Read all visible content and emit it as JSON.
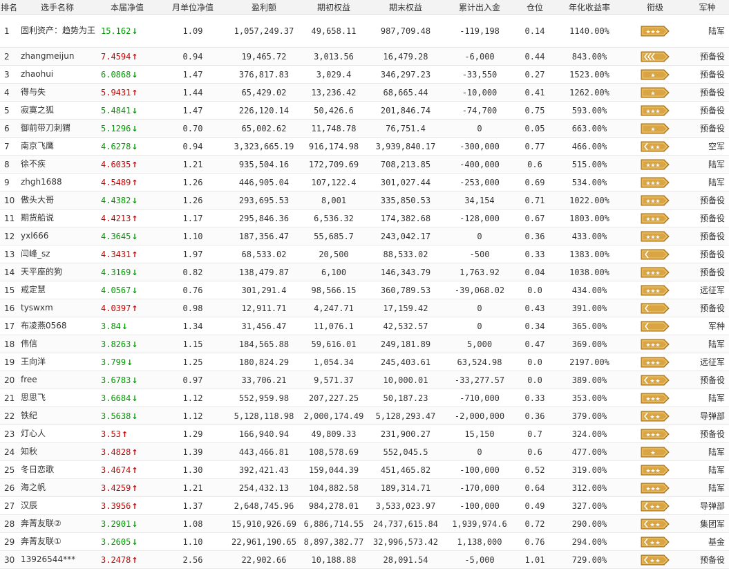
{
  "headers": {
    "rank": "排名",
    "name": "选手名称",
    "nav": "本届净值",
    "monthly": "月单位净值",
    "profit": "盈利额",
    "start": "期初权益",
    "end": "期末权益",
    "flow": "累计出入金",
    "position": "仓位",
    "annual": "年化收益率",
    "rankinsig": "衔级",
    "branch": "军种"
  },
  "colors": {
    "up": "#cc0000",
    "down": "#009900",
    "badge_fill": "#d9a441",
    "badge_border": "#9c6b14"
  },
  "rows": [
    {
      "rank": "1",
      "name": "固利资产：趋势为王",
      "nav": "15.162",
      "dir": "down",
      "monthly": "1.09",
      "profit": "1,057,249.37",
      "start": "49,658.11",
      "end": "987,709.48",
      "flow": "-119,198",
      "position": "0.14",
      "annual": "1140.00%",
      "insignia": "stars",
      "branch": "陆军"
    },
    {
      "rank": "2",
      "name": "zhangmeijun",
      "nav": "7.4594",
      "dir": "up",
      "monthly": "0.94",
      "profit": "19,465.72",
      "start": "3,013.56",
      "end": "16,479.28",
      "flow": "-6,000",
      "position": "0.44",
      "annual": "843.00%",
      "insignia": "chevron-double",
      "branch": "预备役"
    },
    {
      "rank": "3",
      "name": "zhaohui",
      "nav": "6.0868",
      "dir": "down",
      "monthly": "1.47",
      "profit": "376,817.83",
      "start": "3,029.4",
      "end": "346,297.23",
      "flow": "-33,550",
      "position": "0.27",
      "annual": "1523.00%",
      "insignia": "star",
      "branch": "预备役"
    },
    {
      "rank": "4",
      "name": "得与失",
      "nav": "5.9431",
      "dir": "up",
      "monthly": "1.44",
      "profit": "65,429.02",
      "start": "13,236.42",
      "end": "68,665.44",
      "flow": "-10,000",
      "position": "0.41",
      "annual": "1262.00%",
      "insignia": "star",
      "branch": "预备役"
    },
    {
      "rank": "5",
      "name": "寂寞之狐",
      "nav": "5.4841",
      "dir": "down",
      "monthly": "1.47",
      "profit": "226,120.14",
      "start": "50,426.6",
      "end": "201,846.74",
      "flow": "-74,700",
      "position": "0.75",
      "annual": "593.00%",
      "insignia": "stars",
      "branch": "预备役"
    },
    {
      "rank": "6",
      "name": "御前带刀刺猬",
      "nav": "5.1296",
      "dir": "down",
      "monthly": "0.70",
      "profit": "65,002.62",
      "start": "11,748.78",
      "end": "76,751.4",
      "flow": "0",
      "position": "0.05",
      "annual": "663.00%",
      "insignia": "star",
      "branch": "预备役"
    },
    {
      "rank": "7",
      "name": "南京飞鹰",
      "nav": "4.6278",
      "dir": "down",
      "monthly": "0.94",
      "profit": "3,323,665.19",
      "start": "916,174.98",
      "end": "3,939,840.17",
      "flow": "-300,000",
      "position": "0.77",
      "annual": "466.00%",
      "insignia": "chevron-stars",
      "branch": "空军"
    },
    {
      "rank": "8",
      "name": "徐不疾",
      "nav": "4.6035",
      "dir": "up",
      "monthly": "1.21",
      "profit": "935,504.16",
      "start": "172,709.69",
      "end": "708,213.85",
      "flow": "-400,000",
      "position": "0.6",
      "annual": "515.00%",
      "insignia": "stars",
      "branch": "陆军"
    },
    {
      "rank": "9",
      "name": "zhgh1688",
      "nav": "4.5489",
      "dir": "up",
      "monthly": "1.26",
      "profit": "446,905.04",
      "start": "107,122.4",
      "end": "301,027.44",
      "flow": "-253,000",
      "position": "0.69",
      "annual": "534.00%",
      "insignia": "stars",
      "branch": "陆军"
    },
    {
      "rank": "10",
      "name": "傲头大哥",
      "nav": "4.4382",
      "dir": "down",
      "monthly": "1.26",
      "profit": "293,695.53",
      "start": "8,001",
      "end": "335,850.53",
      "flow": "34,154",
      "position": "0.71",
      "annual": "1022.00%",
      "insignia": "stars",
      "branch": "预备役"
    },
    {
      "rank": "11",
      "name": "期货船说",
      "nav": "4.4213",
      "dir": "up",
      "monthly": "1.17",
      "profit": "295,846.36",
      "start": "6,536.32",
      "end": "174,382.68",
      "flow": "-128,000",
      "position": "0.67",
      "annual": "1803.00%",
      "insignia": "stars",
      "branch": "预备役"
    },
    {
      "rank": "12",
      "name": "yxl666",
      "nav": "4.3645",
      "dir": "down",
      "monthly": "1.10",
      "profit": "187,356.47",
      "start": "55,685.7",
      "end": "243,042.17",
      "flow": "0",
      "position": "0.36",
      "annual": "433.00%",
      "insignia": "stars",
      "branch": "预备役"
    },
    {
      "rank": "13",
      "name": "闫峰_sz",
      "nav": "4.3431",
      "dir": "up",
      "monthly": "1.97",
      "profit": "68,533.02",
      "start": "20,500",
      "end": "88,533.02",
      "flow": "-500",
      "position": "0.33",
      "annual": "1383.00%",
      "insignia": "chevron",
      "branch": "预备役"
    },
    {
      "rank": "14",
      "name": "天平座的狗",
      "nav": "4.3169",
      "dir": "down",
      "monthly": "0.82",
      "profit": "138,479.87",
      "start": "6,100",
      "end": "146,343.79",
      "flow": "1,763.92",
      "position": "0.04",
      "annual": "1038.00%",
      "insignia": "stars",
      "branch": "预备役"
    },
    {
      "rank": "15",
      "name": "戒定慧",
      "nav": "4.0567",
      "dir": "down",
      "monthly": "0.76",
      "profit": "301,291.4",
      "start": "98,566.15",
      "end": "360,789.53",
      "flow": "-39,068.02",
      "position": "0.0",
      "annual": "434.00%",
      "insignia": "stars",
      "branch": "远征军"
    },
    {
      "rank": "16",
      "name": "tyswxm",
      "nav": "4.0397",
      "dir": "up",
      "monthly": "0.98",
      "profit": "12,911.71",
      "start": "4,247.71",
      "end": "17,159.42",
      "flow": "0",
      "position": "0.43",
      "annual": "391.00%",
      "insignia": "chevron",
      "branch": "预备役"
    },
    {
      "rank": "17",
      "name": "布凌燕0568",
      "nav": "3.84",
      "dir": "down",
      "monthly": "1.34",
      "profit": "31,456.47",
      "start": "11,076.1",
      "end": "42,532.57",
      "flow": "0",
      "position": "0.34",
      "annual": "365.00%",
      "insignia": "chevron",
      "branch": "军种"
    },
    {
      "rank": "18",
      "name": "伟信",
      "nav": "3.8263",
      "dir": "down",
      "monthly": "1.15",
      "profit": "184,565.88",
      "start": "59,616.01",
      "end": "249,181.89",
      "flow": "5,000",
      "position": "0.47",
      "annual": "369.00%",
      "insignia": "stars",
      "branch": "陆军"
    },
    {
      "rank": "19",
      "name": "王向洋",
      "nav": "3.799",
      "dir": "down",
      "monthly": "1.25",
      "profit": "180,824.29",
      "start": "1,054.34",
      "end": "245,403.61",
      "flow": "63,524.98",
      "position": "0.0",
      "annual": "2197.00%",
      "insignia": "stars",
      "branch": "远征军"
    },
    {
      "rank": "20",
      "name": "free",
      "nav": "3.6783",
      "dir": "down",
      "monthly": "0.97",
      "profit": "33,706.21",
      "start": "9,571.37",
      "end": "10,000.01",
      "flow": "-33,277.57",
      "position": "0.0",
      "annual": "389.00%",
      "insignia": "chevron-stars",
      "branch": "预备役"
    },
    {
      "rank": "21",
      "name": "思思飞",
      "nav": "3.6684",
      "dir": "down",
      "monthly": "1.12",
      "profit": "552,959.98",
      "start": "207,227.25",
      "end": "50,187.23",
      "flow": "-710,000",
      "position": "0.33",
      "annual": "353.00%",
      "insignia": "stars",
      "branch": "陆军"
    },
    {
      "rank": "22",
      "name": "铁纪",
      "nav": "3.5638",
      "dir": "down",
      "monthly": "1.12",
      "profit": "5,128,118.98",
      "start": "2,000,174.49",
      "end": "5,128,293.47",
      "flow": "-2,000,000",
      "position": "0.36",
      "annual": "379.00%",
      "insignia": "chevron-stars",
      "branch": "导弹部"
    },
    {
      "rank": "23",
      "name": "灯心人",
      "nav": "3.53",
      "dir": "up",
      "monthly": "1.29",
      "profit": "166,940.94",
      "start": "49,809.33",
      "end": "231,900.27",
      "flow": "15,150",
      "position": "0.7",
      "annual": "324.00%",
      "insignia": "stars",
      "branch": "预备役"
    },
    {
      "rank": "24",
      "name": "知秋",
      "nav": "3.4828",
      "dir": "up",
      "monthly": "1.39",
      "profit": "443,466.81",
      "start": "108,578.69",
      "end": "552,045.5",
      "flow": "0",
      "position": "0.6",
      "annual": "477.00%",
      "insignia": "star",
      "branch": "陆军"
    },
    {
      "rank": "25",
      "name": "冬日恋歌",
      "nav": "3.4674",
      "dir": "up",
      "monthly": "1.30",
      "profit": "392,421.43",
      "start": "159,044.39",
      "end": "451,465.82",
      "flow": "-100,000",
      "position": "0.52",
      "annual": "319.00%",
      "insignia": "stars",
      "branch": "陆军"
    },
    {
      "rank": "26",
      "name": "海之帆",
      "nav": "3.4259",
      "dir": "up",
      "monthly": "1.21",
      "profit": "254,432.13",
      "start": "104,882.58",
      "end": "189,314.71",
      "flow": "-170,000",
      "position": "0.64",
      "annual": "312.00%",
      "insignia": "stars",
      "branch": "陆军"
    },
    {
      "rank": "27",
      "name": "汉辰",
      "nav": "3.3956",
      "dir": "up",
      "monthly": "1.37",
      "profit": "2,648,745.96",
      "start": "984,278.01",
      "end": "3,533,023.97",
      "flow": "-100,000",
      "position": "0.49",
      "annual": "327.00%",
      "insignia": "chevron-stars",
      "branch": "导弹部"
    },
    {
      "rank": "28",
      "name": "奔菁友联②",
      "nav": "3.2901",
      "dir": "down",
      "monthly": "1.08",
      "profit": "15,910,926.69",
      "start": "6,886,714.55",
      "end": "24,737,615.84",
      "flow": "1,939,974.6",
      "position": "0.72",
      "annual": "290.00%",
      "insignia": "chevron-stars",
      "branch": "集团军"
    },
    {
      "rank": "29",
      "name": "奔菁友联①",
      "nav": "3.2605",
      "dir": "down",
      "monthly": "1.10",
      "profit": "22,961,190.65",
      "start": "8,897,382.77",
      "end": "32,996,573.42",
      "flow": "1,138,000",
      "position": "0.76",
      "annual": "294.00%",
      "insignia": "chevron-stars",
      "branch": "基金"
    },
    {
      "rank": "30",
      "name": "13926544***",
      "nav": "3.2478",
      "dir": "up",
      "monthly": "2.56",
      "profit": "22,902.66",
      "start": "10,188.88",
      "end": "28,091.54",
      "flow": "-5,000",
      "position": "1.01",
      "annual": "729.00%",
      "insignia": "chevron-stars",
      "branch": "预备役"
    }
  ]
}
